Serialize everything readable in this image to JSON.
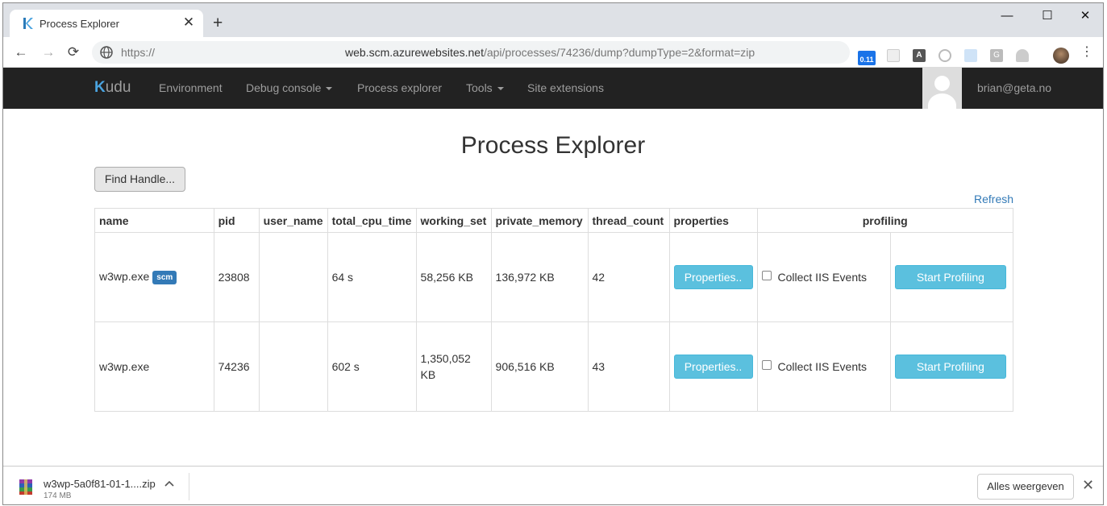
{
  "browser": {
    "tab_title": "Process Explorer",
    "tab_close": "✕",
    "new_tab": "+",
    "window_controls": [
      "—",
      "☐",
      "✕"
    ],
    "nav": {
      "back": "←",
      "forward": "→",
      "reload": "⟳"
    },
    "url_scheme": "https://",
    "url_host": "web.scm.azurewebsites.net",
    "url_path": "/api/processes/74236/dump?dumpType=2&format=zip",
    "extension_badge": "0.11",
    "extension_icons": [
      "json-viewer-icon",
      "font-icon",
      "timer-icon",
      "translate-icon",
      "grammar-icon",
      "cloud-icon"
    ],
    "menu": "⋮"
  },
  "navbar": {
    "brand_k": "K",
    "brand_rest": "udu",
    "items": [
      "Environment",
      "Debug console",
      "Process explorer",
      "Tools",
      "Site extensions"
    ],
    "user": "brian@geta.no"
  },
  "page": {
    "title": "Process Explorer",
    "find_handle": "Find Handle...",
    "refresh": "Refresh"
  },
  "table": {
    "headers": [
      "name",
      "pid",
      "user_name",
      "total_cpu_time",
      "working_set",
      "private_memory",
      "thread_count",
      "properties",
      "profiling"
    ],
    "rows": [
      {
        "name": "w3wp.exe",
        "badge": "scm",
        "pid": "23808",
        "user_name": "",
        "total_cpu_time": "64 s",
        "working_set": "58,256 KB",
        "private_memory": "136,972 KB",
        "thread_count": "42",
        "properties_btn": "Properties..",
        "iis_label": "Collect IIS Events",
        "profiling_btn": "Start Profiling"
      },
      {
        "name": "w3wp.exe",
        "badge": "",
        "pid": "74236",
        "user_name": "",
        "total_cpu_time": "602 s",
        "working_set": "1,350,052 KB",
        "private_memory": "906,516 KB",
        "thread_count": "43",
        "properties_btn": "Properties..",
        "iis_label": "Collect IIS Events",
        "profiling_btn": "Start Profiling"
      }
    ]
  },
  "download": {
    "filename": "w3wp-5a0f81-01-1....zip",
    "size": "174 MB",
    "show_all": "Alles weergeven",
    "close": "✕"
  },
  "colors": {
    "navbar_bg": "#222222",
    "brand_accent": "#4aa3df",
    "info_button": "#5bc0de",
    "scm_badge": "#337ab7",
    "link": "#337ab7"
  }
}
